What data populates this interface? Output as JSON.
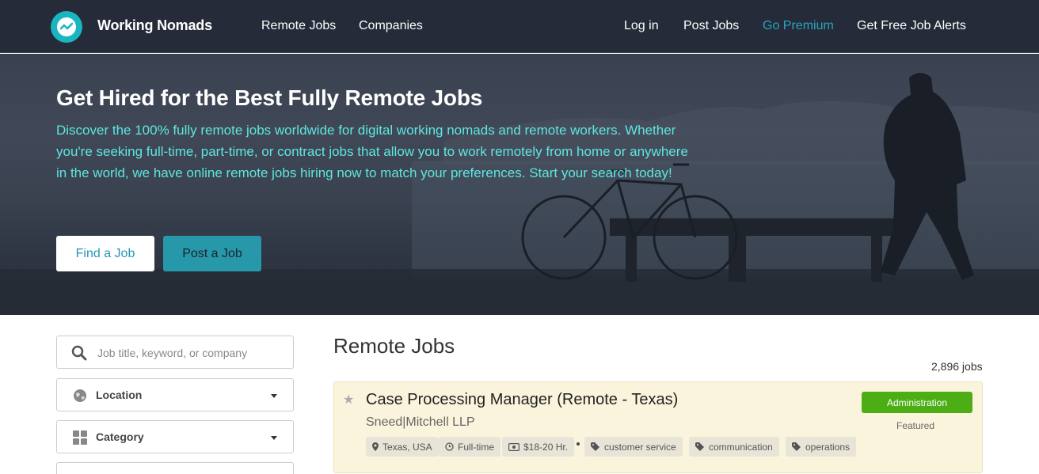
{
  "nav": {
    "brand": "Working Nomads",
    "links": [
      "Remote Jobs",
      "Companies"
    ],
    "right_links": [
      "Log in",
      "Post Jobs",
      "Go Premium",
      "Get Free Job Alerts"
    ],
    "accent_color": "#27a5bf"
  },
  "hero": {
    "title": "Get Hired for the Best Fully Remote Jobs",
    "description": "Discover the 100% fully remote jobs worldwide for digital working nomads and remote workers. Whether you're seeking full-time, part-time, or contract jobs that allow you to work remotely from home or anywhere in the world, we have online remote jobs hiring now to match your preferences. Start your search today!",
    "find_button": "Find a Job",
    "post_button": "Post a Job"
  },
  "filters": {
    "search_placeholder": "Job title, keyword, or company",
    "location_label": "Location",
    "category_label": "Category"
  },
  "main": {
    "title": "Remote Jobs",
    "count": "2,896 jobs",
    "jobs": [
      {
        "title": "Case Processing Manager (Remote - Texas)",
        "company": "Sneed|Mitchell LLP",
        "location": "Texas, USA",
        "type": "Full-time",
        "salary": "$18-20 Hr.",
        "tags": [
          "customer service",
          "communication",
          "operations"
        ],
        "category": "Administration",
        "category_color": "#4cae14",
        "badge": "Featured"
      }
    ]
  }
}
